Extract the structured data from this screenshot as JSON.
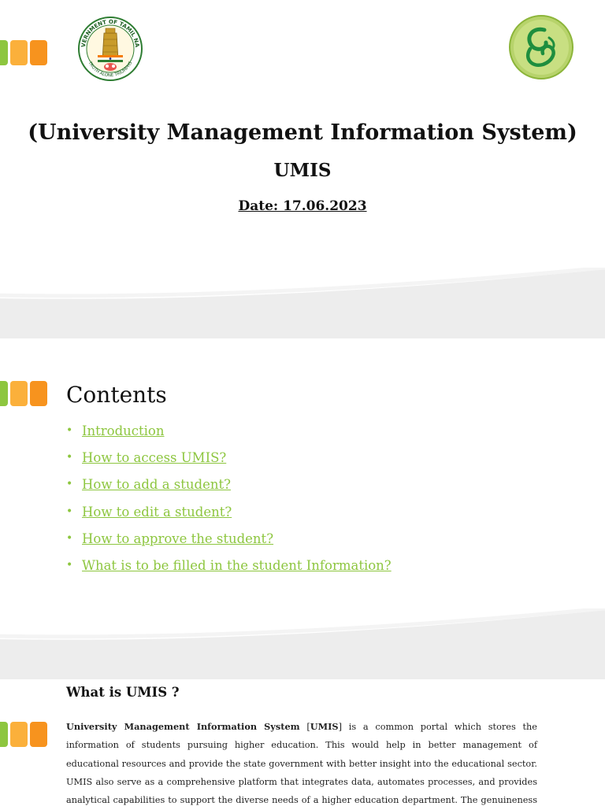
{
  "colors": {
    "square_green": "#8dc63f",
    "square_yellow": "#fbb03b",
    "square_orange": "#f7931e",
    "link_green": "#8dc63f",
    "band_grey": "#ededed"
  },
  "slide1": {
    "left_logo": {
      "ring_top_text": "GOVERNMENT OF TAMIL NADU",
      "ring_bottom_text": "TRUTH ALONE TRIUMPHS"
    },
    "right_logo_icon": "umis-swirl-logo",
    "title_line1": "(University Management Information System)",
    "title_line2": "UMIS",
    "date_line": "Date: 17.06.2023"
  },
  "slide2": {
    "heading": "Contents",
    "items": [
      "Introduction",
      "How to access UMIS?",
      "How to add a student?",
      "How to edit a student? ",
      "How to approve the student?",
      "What is to be filled in the student Information?"
    ]
  },
  "slide3": {
    "heading": "What is UMIS ?",
    "paragraph_bold": "University Management Information System",
    "paragraph_bracket_open": " [",
    "paragraph_bold2": "UMIS",
    "paragraph_rest": "] is a common portal which stores the information of students pursuing higher education. This would help in better management of educational resources and provide the state government with better insight into the educational sector. UMIS also serve as a comprehensive platform that integrates data, automates processes, and provides analytical capabilities to support the diverse needs of a higher education department. The genuineness of student data should be"
  }
}
